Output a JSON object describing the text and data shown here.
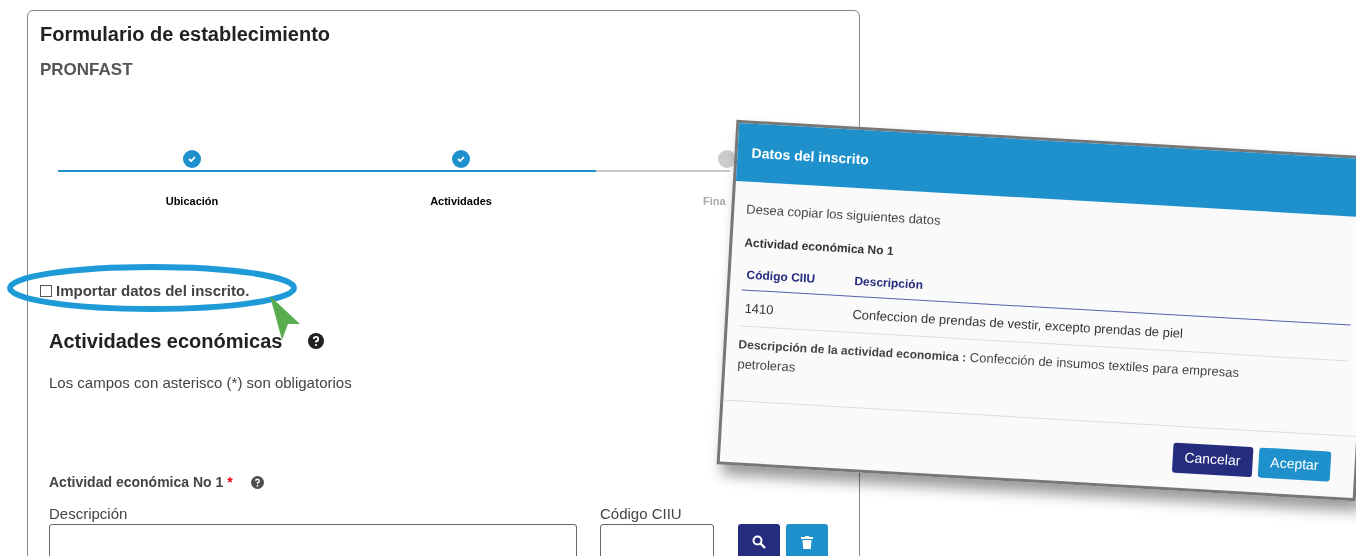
{
  "form": {
    "title": "Formulario de establecimiento",
    "subtitle": "PRONFAST",
    "steps": [
      {
        "label": "Ubicación",
        "done": true
      },
      {
        "label": "Actividades",
        "done": true
      },
      {
        "label": "Fina",
        "done": false
      }
    ],
    "import_checkbox": {
      "label": "Importar datos del inscrito.",
      "checked": false
    },
    "section_title": "Actividades económicas",
    "required_note": "Los campos con asterisco (*) son obligatorios",
    "activity": {
      "title": "Actividad económica No 1",
      "required_mark": "*",
      "description_label": "Descripción",
      "code_label": "Código CIIU"
    }
  },
  "dialog": {
    "title": "Datos del inscrito",
    "prompt": "Desea copiar los siguientes datos",
    "activity_title": "Actividad económica No 1",
    "columns": [
      "Código CIIU",
      "Descripción"
    ],
    "rows": [
      [
        "1410",
        "Confeccion de prendas de vestir, excepto prendas de piel"
      ]
    ],
    "description_label": "Descripción de la actividad economica :",
    "description_value": "Confección de insumos textiles para empresas petroleras",
    "buttons": [
      {
        "label": "Cancelar",
        "kind": "secondary"
      },
      {
        "label": "Aceptar",
        "kind": "primary"
      }
    ]
  }
}
